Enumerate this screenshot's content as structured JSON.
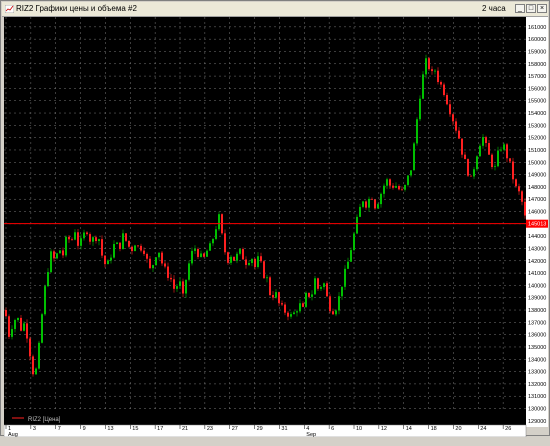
{
  "window": {
    "title": "RIZ2 Графики цены и объема #2",
    "timeframe": "2 часа",
    "buttons": {
      "minimize": "_",
      "maximize": "□",
      "close": "×"
    }
  },
  "colors": {
    "background": "#000000",
    "grid": "#7a7a7a",
    "bull": "#00c000",
    "bear": "#ff2020",
    "price_line": "#ff0000",
    "axis_bg": "#ffffff"
  },
  "legend": {
    "series": "RIZ2 [Цена]"
  },
  "price_label": "145013",
  "chart_data": {
    "type": "candlestick",
    "title": "",
    "y_axis": {
      "labels": [
        "161000",
        "160000",
        "159000",
        "158000",
        "157000",
        "156000",
        "155000",
        "154000",
        "153000",
        "152000",
        "151000",
        "150000",
        "149000",
        "148000",
        "147000",
        "146000",
        "145000",
        "144000",
        "143000",
        "142000",
        "141000",
        "140000",
        "139000",
        "138000",
        "137000",
        "136000",
        "135000",
        "134000",
        "133000",
        "132000",
        "131000",
        "130000",
        "129000"
      ],
      "min": 128500,
      "max": 161800
    },
    "x_axis": {
      "day_labels": [
        "1",
        "3",
        "7",
        "9",
        "13",
        "15",
        "17",
        "21",
        "23",
        "27",
        "29",
        "31",
        "4",
        "6",
        "10",
        "12",
        "14",
        "18",
        "20",
        "24",
        "26"
      ],
      "month_labels": [
        "Aug",
        "Sep"
      ]
    },
    "current_price": 145013,
    "close_path": [
      [
        0,
        138000
      ],
      [
        4,
        136000
      ],
      [
        8,
        137000
      ],
      [
        12,
        137500
      ],
      [
        16,
        136500
      ],
      [
        20,
        137000
      ],
      [
        24,
        135000
      ],
      [
        28,
        133000
      ],
      [
        30,
        132500
      ],
      [
        34,
        135000
      ],
      [
        38,
        138500
      ],
      [
        42,
        141000
      ],
      [
        46,
        142500
      ],
      [
        50,
        142000
      ],
      [
        54,
        143000
      ],
      [
        58,
        142500
      ],
      [
        62,
        144000
      ],
      [
        66,
        143500
      ],
      [
        70,
        144500
      ],
      [
        74,
        143000
      ],
      [
        78,
        144000
      ],
      [
        82,
        144500
      ],
      [
        86,
        143500
      ],
      [
        90,
        144000
      ],
      [
        94,
        143800
      ],
      [
        98,
        142000
      ],
      [
        102,
        141500
      ],
      [
        106,
        142500
      ],
      [
        110,
        143500
      ],
      [
        114,
        143000
      ],
      [
        118,
        144000
      ],
      [
        122,
        143500
      ],
      [
        126,
        142800
      ],
      [
        130,
        143500
      ],
      [
        134,
        143000
      ],
      [
        138,
        143200
      ],
      [
        142,
        142000
      ],
      [
        146,
        141000
      ],
      [
        150,
        142500
      ],
      [
        154,
        142800
      ],
      [
        158,
        141500
      ],
      [
        162,
        141000
      ],
      [
        166,
        140500
      ],
      [
        170,
        139500
      ],
      [
        174,
        140500
      ],
      [
        178,
        139000
      ],
      [
        182,
        141000
      ],
      [
        186,
        142500
      ],
      [
        190,
        143000
      ],
      [
        194,
        142500
      ],
      [
        198,
        142000
      ],
      [
        202,
        142800
      ],
      [
        206,
        143200
      ],
      [
        210,
        144500
      ],
      [
        214,
        145500
      ],
      [
        218,
        143500
      ],
      [
        222,
        142000
      ],
      [
        226,
        142500
      ],
      [
        230,
        142000
      ],
      [
        234,
        142800
      ],
      [
        238,
        142300
      ],
      [
        242,
        141800
      ],
      [
        246,
        142500
      ],
      [
        250,
        141500
      ],
      [
        254,
        142300
      ],
      [
        258,
        141000
      ],
      [
        262,
        140500
      ],
      [
        266,
        139000
      ],
      [
        270,
        139500
      ],
      [
        274,
        138500
      ],
      [
        278,
        138000
      ],
      [
        282,
        137800
      ],
      [
        286,
        137500
      ],
      [
        290,
        137800
      ],
      [
        294,
        138500
      ],
      [
        298,
        138000
      ],
      [
        302,
        139500
      ],
      [
        306,
        139000
      ],
      [
        310,
        140500
      ],
      [
        314,
        139500
      ],
      [
        318,
        140500
      ],
      [
        322,
        139000
      ],
      [
        326,
        138000
      ],
      [
        330,
        138000
      ],
      [
        334,
        139000
      ],
      [
        338,
        140500
      ],
      [
        342,
        141500
      ],
      [
        346,
        143000
      ],
      [
        350,
        144500
      ],
      [
        354,
        146000
      ],
      [
        358,
        147000
      ],
      [
        362,
        146500
      ],
      [
        366,
        147500
      ],
      [
        370,
        146500
      ],
      [
        374,
        147000
      ],
      [
        378,
        148000
      ],
      [
        382,
        148500
      ],
      [
        386,
        148000
      ],
      [
        390,
        148200
      ],
      [
        394,
        147800
      ],
      [
        398,
        147500
      ],
      [
        402,
        148500
      ],
      [
        406,
        149500
      ],
      [
        410,
        152000
      ],
      [
        414,
        155000
      ],
      [
        418,
        157000
      ],
      [
        422,
        158500
      ],
      [
        426,
        157000
      ],
      [
        430,
        157500
      ],
      [
        434,
        156500
      ],
      [
        438,
        156000
      ],
      [
        442,
        155000
      ],
      [
        446,
        154000
      ],
      [
        450,
        153000
      ],
      [
        454,
        152000
      ],
      [
        458,
        150500
      ],
      [
        462,
        149500
      ],
      [
        466,
        148500
      ],
      [
        470,
        150000
      ],
      [
        474,
        151500
      ],
      [
        478,
        152000
      ],
      [
        482,
        151000
      ],
      [
        486,
        150000
      ],
      [
        490,
        149500
      ],
      [
        494,
        151000
      ],
      [
        498,
        151500
      ],
      [
        502,
        150500
      ],
      [
        506,
        149500
      ],
      [
        510,
        148000
      ],
      [
        514,
        147500
      ],
      [
        518,
        146500
      ],
      [
        520,
        145500
      ]
    ]
  }
}
